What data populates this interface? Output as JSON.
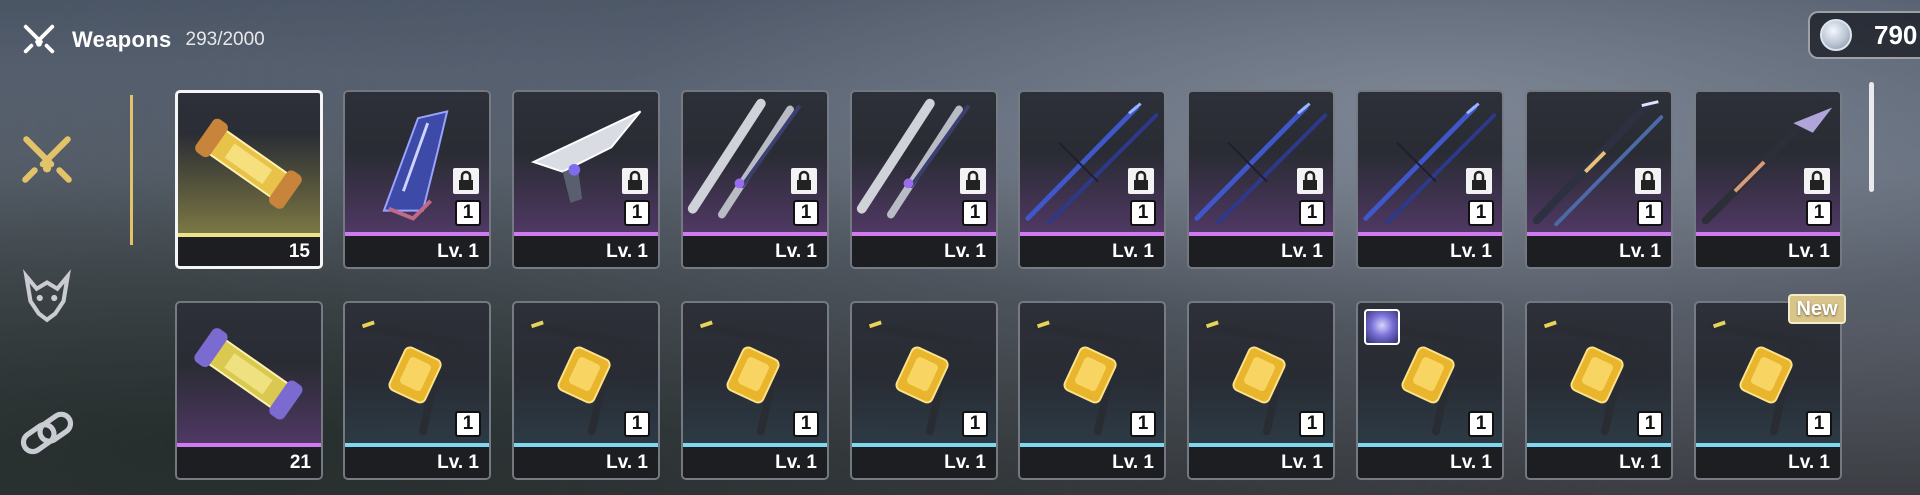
{
  "header": {
    "title": "Weapons",
    "count": "293/2000",
    "icon": "crossed-swords-icon"
  },
  "currency": {
    "value": "790",
    "icon": "silver-coin-icon"
  },
  "sidebar": {
    "tabs": [
      {
        "name": "weapons",
        "icon": "crossed-swords-icon",
        "active": true
      },
      {
        "name": "matrices",
        "icon": "demon-mask-icon",
        "active": false
      },
      {
        "name": "relics",
        "icon": "chain-link-icon",
        "active": false
      }
    ]
  },
  "rows": [
    [
      {
        "type": "material",
        "label": "15",
        "rarity": "gold",
        "locked": false,
        "selected": true,
        "icon": "gold-capsule-icon"
      },
      {
        "type": "weapon",
        "label": "Lv. 1",
        "rank": "1",
        "rarity": "purple",
        "locked": true,
        "icon": "blue-gauntlet-weapon-icon"
      },
      {
        "type": "weapon",
        "label": "Lv. 1",
        "rank": "1",
        "rarity": "purple",
        "locked": true,
        "icon": "silver-blade-weapon-icon"
      },
      {
        "type": "weapon",
        "label": "Lv. 1",
        "rank": "1",
        "rarity": "purple",
        "locked": true,
        "icon": "twin-sabers-weapon-icon"
      },
      {
        "type": "weapon",
        "label": "Lv. 1",
        "rank": "1",
        "rarity": "purple",
        "locked": true,
        "icon": "twin-sabers-weapon-icon"
      },
      {
        "type": "weapon",
        "label": "Lv. 1",
        "rank": "1",
        "rarity": "purple",
        "locked": true,
        "icon": "blue-spears-weapon-icon"
      },
      {
        "type": "weapon",
        "label": "Lv. 1",
        "rank": "1",
        "rarity": "purple",
        "locked": true,
        "icon": "blue-spears-weapon-icon"
      },
      {
        "type": "weapon",
        "label": "Lv. 1",
        "rank": "1",
        "rarity": "purple",
        "locked": true,
        "icon": "blue-spears-weapon-icon"
      },
      {
        "type": "weapon",
        "label": "Lv. 1",
        "rank": "1",
        "rarity": "purple",
        "locked": true,
        "icon": "staff-weapon-icon"
      },
      {
        "type": "weapon",
        "label": "Lv. 1",
        "rank": "1",
        "rarity": "purple",
        "locked": true,
        "icon": "scythe-weapon-icon"
      }
    ],
    [
      {
        "type": "material",
        "label": "21",
        "rarity": "purple",
        "locked": false,
        "selected": false,
        "icon": "purple-capsule-icon"
      },
      {
        "type": "weapon",
        "label": "Lv. 1",
        "rank": "1",
        "rarity": "blue",
        "locked": false,
        "icon": "gold-crossbow-weapon-icon"
      },
      {
        "type": "weapon",
        "label": "Lv. 1",
        "rank": "1",
        "rarity": "blue",
        "locked": false,
        "icon": "gold-crossbow-weapon-icon"
      },
      {
        "type": "weapon",
        "label": "Lv. 1",
        "rank": "1",
        "rarity": "blue",
        "locked": false,
        "icon": "gold-crossbow-weapon-icon"
      },
      {
        "type": "weapon",
        "label": "Lv. 1",
        "rank": "1",
        "rarity": "blue",
        "locked": false,
        "icon": "gold-crossbow-weapon-icon"
      },
      {
        "type": "weapon",
        "label": "Lv. 1",
        "rank": "1",
        "rarity": "blue",
        "locked": false,
        "icon": "gold-crossbow-weapon-icon"
      },
      {
        "type": "weapon",
        "label": "Lv. 1",
        "rank": "1",
        "rarity": "blue",
        "locked": false,
        "icon": "gold-crossbow-weapon-icon"
      },
      {
        "type": "weapon",
        "label": "Lv. 1",
        "rank": "1",
        "rarity": "blue",
        "locked": false,
        "equipped": true,
        "icon": "gold-crossbow-weapon-icon"
      },
      {
        "type": "weapon",
        "label": "Lv. 1",
        "rank": "1",
        "rarity": "blue",
        "locked": false,
        "icon": "gold-crossbow-weapon-icon"
      },
      {
        "type": "weapon",
        "label": "Lv. 1",
        "rank": "1",
        "rarity": "blue",
        "locked": false,
        "new": true,
        "icon": "gold-crossbow-weapon-icon"
      }
    ]
  ],
  "new_badge": {
    "label": "New"
  },
  "colors": {
    "accent_gold": "#e3c36a",
    "rarity_purple": "#d07af0",
    "rarity_blue": "#7fd8ef",
    "rarity_gold": "#ebe28a"
  }
}
